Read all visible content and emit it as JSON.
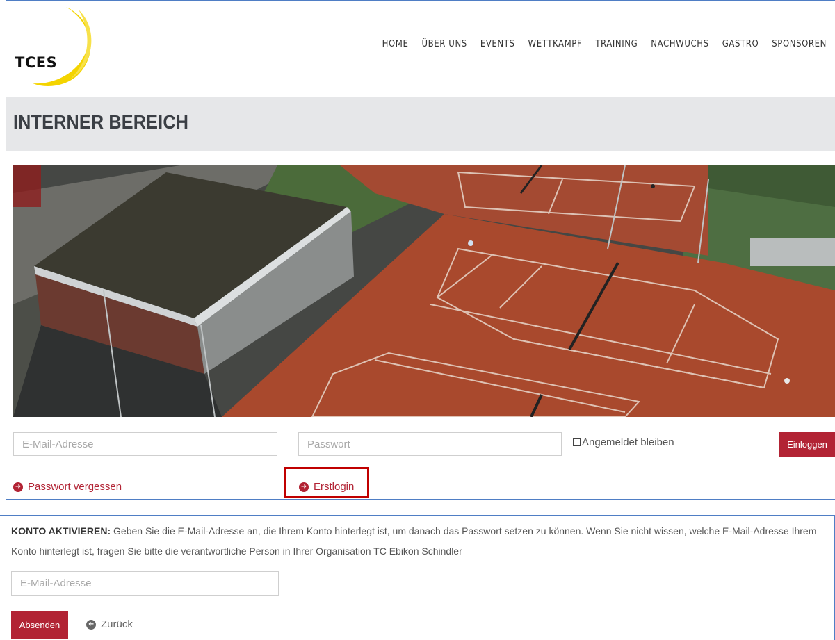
{
  "header": {
    "logo_text": "TCES",
    "nav": [
      "HOME",
      "ÜBER UNS",
      "EVENTS",
      "WETTKAMPF",
      "TRAINING",
      "NACHWUCHS",
      "GASTRO",
      "SPONSOREN"
    ]
  },
  "page_title": "INTERNER BEREICH",
  "login": {
    "email_placeholder": "E-Mail-Adresse",
    "password_placeholder": "Passwort",
    "remember_label": "Angemeldet bleiben",
    "login_button": "Einloggen",
    "forgot_link": "Passwort vergessen",
    "first_login_link": "Erstlogin"
  },
  "activate": {
    "heading": "KONTO AKTIVIEREN:",
    "text": " Geben Sie die E-Mail-Adresse an, die Ihrem Konto hinterlegt ist, um danach das Passwort setzen zu können. Wenn Sie nicht wissen, welche E-Mail-Adresse Ihrem Konto hinterlegt ist, fragen Sie bitte die verantwortliche Person in Ihrer Organisation TC Ebikon Schindler",
    "email_placeholder": "E-Mail-Adresse",
    "submit_button": "Absenden",
    "back_link": "Zurück"
  },
  "colors": {
    "accent": "#b22334",
    "band": "#e6e7e9",
    "highlight": "#c00000",
    "logo_swoosh": "#f4d400"
  },
  "icons": [
    "arrow-circle-right-icon",
    "arrow-circle-left-icon",
    "logo-swoosh-icon"
  ]
}
